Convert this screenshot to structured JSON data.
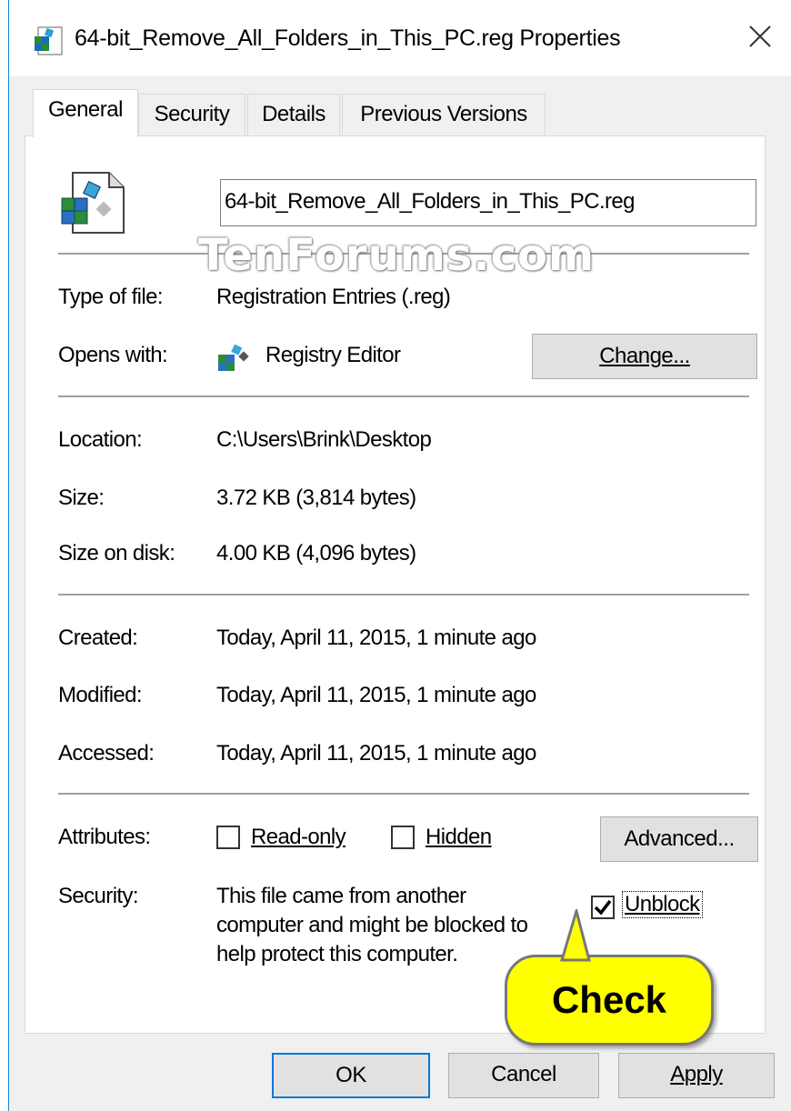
{
  "window": {
    "title": "64-bit_Remove_All_Folders_in_This_PC.reg Properties",
    "close_glyph": "✕"
  },
  "tabs": [
    {
      "label": "General",
      "active": true
    },
    {
      "label": "Security",
      "active": false
    },
    {
      "label": "Details",
      "active": false
    },
    {
      "label": "Previous Versions",
      "active": false
    }
  ],
  "file": {
    "name": "64-bit_Remove_All_Folders_in_This_PC.reg",
    "icon": "registry-file-icon"
  },
  "watermark": "TenForums.com",
  "type": {
    "label": "Type of file:",
    "value": "Registration Entries (.reg)"
  },
  "opens_with": {
    "label": "Opens with:",
    "value": "Registry Editor",
    "icon": "registry-editor-icon",
    "change_label": "Change..."
  },
  "location": {
    "label": "Location:",
    "value": "C:\\Users\\Brink\\Desktop"
  },
  "size": {
    "label": "Size:",
    "value": "3.72 KB (3,814 bytes)"
  },
  "size_on_disk": {
    "label": "Size on disk:",
    "value": "4.00 KB (4,096 bytes)"
  },
  "created": {
    "label": "Created:",
    "value": "Today, April 11, 2015, 1 minute ago"
  },
  "modified": {
    "label": "Modified:",
    "value": "Today, April 11, 2015, 1 minute ago"
  },
  "accessed": {
    "label": "Accessed:",
    "value": "Today, April 11, 2015, 1 minute ago"
  },
  "attributes": {
    "label": "Attributes:",
    "readonly_label": "Read-only",
    "readonly_checked": false,
    "hidden_label": "Hidden",
    "hidden_checked": false,
    "advanced_label": "Advanced..."
  },
  "security": {
    "label": "Security:",
    "line1": "This file came from another",
    "line2": "computer and might be blocked to",
    "line3": "help protect this computer.",
    "unblock_label": "Unblock",
    "unblock_checked": true
  },
  "callout": {
    "text": "Check",
    "color": "#ffff00"
  },
  "buttons": {
    "ok": "OK",
    "cancel": "Cancel",
    "apply": "Apply"
  },
  "colors": {
    "accent": "#1883d7",
    "dialog_bg": "#f0f0f0",
    "button_bg": "#e1e1e1"
  }
}
